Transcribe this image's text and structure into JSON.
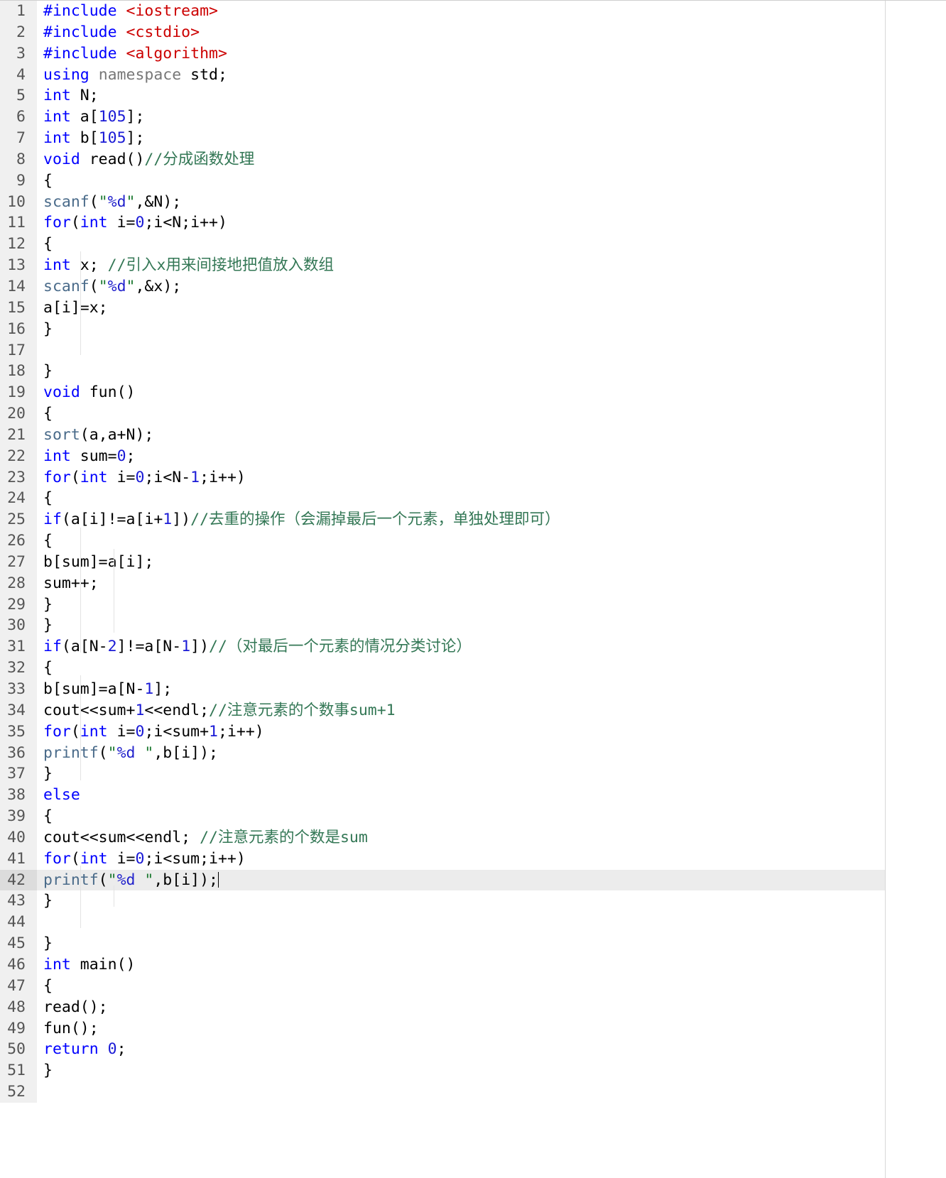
{
  "editor": {
    "language": "cpp",
    "active_line": 42,
    "total_lines": 52,
    "gutter_bg": "#f0f0f0",
    "active_line_bg": "#ececec",
    "colors": {
      "keyword": "#0000ff",
      "include_path": "#cc0000",
      "comment": "#337755",
      "string": "#1e7a32",
      "number": "#1a1ad6",
      "library_function": "#4a6b8a",
      "plain": "#000000"
    }
  },
  "lines": [
    {
      "n": "1",
      "fold": false,
      "text": "#include <iostream>"
    },
    {
      "n": "2",
      "fold": false,
      "text": "#include <cstdio>"
    },
    {
      "n": "3",
      "fold": false,
      "text": "#include <algorithm>"
    },
    {
      "n": "4",
      "fold": false,
      "text": "using namespace std;"
    },
    {
      "n": "5",
      "fold": false,
      "text": "int N;"
    },
    {
      "n": "6",
      "fold": false,
      "text": "int a[105];"
    },
    {
      "n": "7",
      "fold": false,
      "text": "int b[105];"
    },
    {
      "n": "8",
      "fold": false,
      "text": "void read()//分成函数处理"
    },
    {
      "n": "9",
      "fold": true,
      "text": "{"
    },
    {
      "n": "10",
      "fold": false,
      "text": "    scanf(\"%d\",&N);"
    },
    {
      "n": "11",
      "fold": false,
      "text": "    for(int i=0;i<N;i++)"
    },
    {
      "n": "12",
      "fold": true,
      "text": "    {"
    },
    {
      "n": "13",
      "fold": false,
      "text": "        int x;                //引入x用来间接地把值放入数组"
    },
    {
      "n": "14",
      "fold": false,
      "text": "        scanf(\"%d\",&x);"
    },
    {
      "n": "15",
      "fold": false,
      "text": "        a[i]=x;"
    },
    {
      "n": "16",
      "fold": false,
      "text": "    }"
    },
    {
      "n": "17",
      "fold": false,
      "text": ""
    },
    {
      "n": "18",
      "fold": false,
      "text": "}"
    },
    {
      "n": "19",
      "fold": false,
      "text": "void fun()"
    },
    {
      "n": "20",
      "fold": true,
      "text": "{"
    },
    {
      "n": "21",
      "fold": false,
      "text": "    sort(a,a+N);"
    },
    {
      "n": "22",
      "fold": false,
      "text": "    int sum=0;"
    },
    {
      "n": "23",
      "fold": false,
      "text": "    for(int i=0;i<N-1;i++)"
    },
    {
      "n": "24",
      "fold": true,
      "text": "    {"
    },
    {
      "n": "25",
      "fold": false,
      "text": "        if(a[i]!=a[i+1])//去重的操作（会漏掉最后一个元素，单独处理即可）"
    },
    {
      "n": "26",
      "fold": true,
      "text": "        {"
    },
    {
      "n": "27",
      "fold": false,
      "text": "            b[sum]=a[i];"
    },
    {
      "n": "28",
      "fold": false,
      "text": "            sum++;"
    },
    {
      "n": "29",
      "fold": false,
      "text": "        }"
    },
    {
      "n": "30",
      "fold": false,
      "text": "    }"
    },
    {
      "n": "31",
      "fold": false,
      "text": "    if(a[N-2]!=a[N-1])//（对最后一个元素的情况分类讨论）"
    },
    {
      "n": "32",
      "fold": true,
      "text": "    {"
    },
    {
      "n": "33",
      "fold": false,
      "text": "        b[sum]=a[N-1];"
    },
    {
      "n": "34",
      "fold": false,
      "text": "        cout<<sum+1<<endl;//注意元素的个数事sum+1"
    },
    {
      "n": "35",
      "fold": false,
      "text": "        for(int i=0;i<sum+1;i++)"
    },
    {
      "n": "36",
      "fold": false,
      "text": "            printf(\"%d \",b[i]);"
    },
    {
      "n": "37",
      "fold": false,
      "text": "    }"
    },
    {
      "n": "38",
      "fold": false,
      "text": "    else"
    },
    {
      "n": "39",
      "fold": true,
      "text": "    {"
    },
    {
      "n": "40",
      "fold": false,
      "text": "    cout<<sum<<endl;     //注意元素的个数是sum"
    },
    {
      "n": "41",
      "fold": false,
      "text": "    for(int i=0;i<sum;i++)"
    },
    {
      "n": "42",
      "fold": false,
      "text": "        printf(\"%d \",b[i]);"
    },
    {
      "n": "43",
      "fold": false,
      "text": "    }"
    },
    {
      "n": "44",
      "fold": false,
      "text": ""
    },
    {
      "n": "45",
      "fold": false,
      "text": "}"
    },
    {
      "n": "46",
      "fold": false,
      "text": "int main()"
    },
    {
      "n": "47",
      "fold": true,
      "text": "{"
    },
    {
      "n": "48",
      "fold": false,
      "text": "    read();"
    },
    {
      "n": "49",
      "fold": false,
      "text": "    fun();"
    },
    {
      "n": "50",
      "fold": false,
      "text": "    return 0;"
    },
    {
      "n": "51",
      "fold": false,
      "text": "}"
    },
    {
      "n": "52",
      "fold": false,
      "text": ""
    }
  ]
}
